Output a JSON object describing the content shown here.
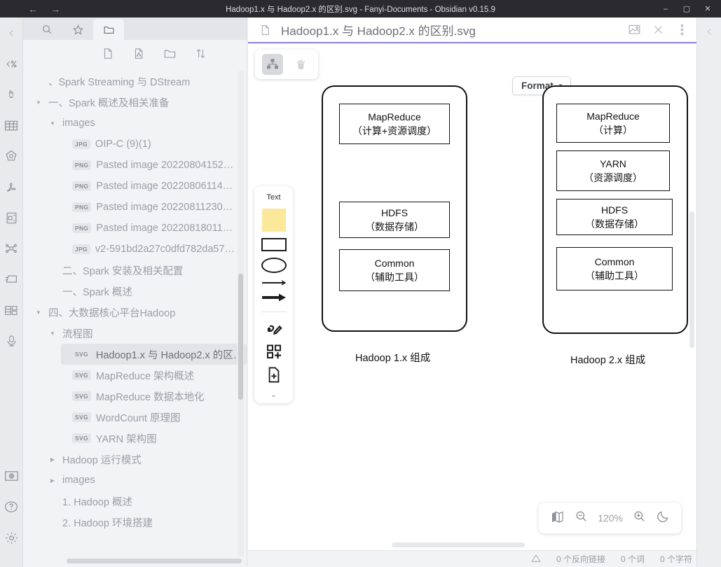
{
  "window": {
    "title": "Hadoop1.x 与 Hadoop2.x 的区别.svg - Fanyi-Documents - Obsidian v0.15.9",
    "back_icon": "arrow-left-icon",
    "forward_icon": "arrow-right-icon",
    "minimize": "–",
    "maximize": "▢",
    "close": "✕"
  },
  "rail": {
    "items": [
      {
        "name": "collapse-chevron-icon",
        "glyph": "chevron-left"
      },
      {
        "name": "percent-code-icon",
        "glyph": "code-percent"
      },
      {
        "name": "clip-icon",
        "glyph": "clip"
      },
      {
        "name": "table-icon",
        "glyph": "table"
      },
      {
        "name": "shape-icon",
        "glyph": "polygon"
      },
      {
        "name": "pdf-icon",
        "glyph": "pdf"
      },
      {
        "name": "card-icon",
        "glyph": "card"
      },
      {
        "name": "graph-icon",
        "glyph": "graph"
      },
      {
        "name": "layers-icon",
        "glyph": "layers"
      },
      {
        "name": "grid-icon",
        "glyph": "grid"
      },
      {
        "name": "microphone-icon",
        "glyph": "mic"
      },
      {
        "name": "camera-icon",
        "glyph": "camera"
      },
      {
        "name": "help-icon",
        "glyph": "question"
      },
      {
        "name": "settings-icon",
        "glyph": "gear"
      }
    ]
  },
  "sidebar": {
    "tabs": [
      {
        "name": "search-tab",
        "icon": "search-icon",
        "active": false
      },
      {
        "name": "bookmark-tab",
        "icon": "star-icon",
        "active": false
      },
      {
        "name": "files-tab",
        "icon": "folder-icon",
        "active": true
      }
    ],
    "actions": [
      {
        "name": "new-note-action",
        "icon": "new-file-icon"
      },
      {
        "name": "new-drawing-action",
        "icon": "drawing-file-icon"
      },
      {
        "name": "new-folder-action",
        "icon": "new-folder-icon"
      },
      {
        "name": "sort-action",
        "icon": "sort-icon"
      }
    ],
    "tree": [
      {
        "label": "、Spark Streaming 与 DStream",
        "indent": 1,
        "arrow": "",
        "badge": "",
        "selected": false,
        "clipped": true
      },
      {
        "label": "一、Spark 概述及相关准备",
        "indent": 1,
        "arrow": "▼",
        "badge": "",
        "selected": false
      },
      {
        "label": "images",
        "indent": 2,
        "arrow": "▼",
        "badge": "",
        "selected": false
      },
      {
        "label": "OIP-C (9)(1)",
        "indent": 3,
        "arrow": "",
        "badge": "JPG",
        "selected": false
      },
      {
        "label": "Pasted image 20220804152…",
        "indent": 3,
        "arrow": "",
        "badge": "PNG",
        "selected": false
      },
      {
        "label": "Pasted image 20220806114…",
        "indent": 3,
        "arrow": "",
        "badge": "PNG",
        "selected": false
      },
      {
        "label": "Pasted image 20220811230…",
        "indent": 3,
        "arrow": "",
        "badge": "PNG",
        "selected": false
      },
      {
        "label": "Pasted image 20220818011…",
        "indent": 3,
        "arrow": "",
        "badge": "PNG",
        "selected": false
      },
      {
        "label": "v2-591bd2a27c0dfd782da57…",
        "indent": 3,
        "arrow": "",
        "badge": "JPG",
        "selected": false
      },
      {
        "label": "二、Spark 安装及相关配置",
        "indent": 2,
        "arrow": "",
        "badge": "",
        "selected": false
      },
      {
        "label": "一、Spark 概述",
        "indent": 2,
        "arrow": "",
        "badge": "",
        "selected": false
      },
      {
        "label": "四、大数据核心平台Hadoop",
        "indent": 1,
        "arrow": "▼",
        "badge": "",
        "selected": false
      },
      {
        "label": "流程图",
        "indent": 2,
        "arrow": "▼",
        "badge": "",
        "selected": false
      },
      {
        "label": "Hadoop1.x 与 Hadoop2.x 的区…",
        "indent": 3,
        "arrow": "",
        "badge": "SVG",
        "selected": true
      },
      {
        "label": "MapReduce 架构概述",
        "indent": 3,
        "arrow": "",
        "badge": "SVG",
        "selected": false
      },
      {
        "label": "MapReduce 数据本地化",
        "indent": 3,
        "arrow": "",
        "badge": "SVG",
        "selected": false
      },
      {
        "label": "WordCount 原理图",
        "indent": 3,
        "arrow": "",
        "badge": "SVG",
        "selected": false
      },
      {
        "label": "YARN 架构图",
        "indent": 3,
        "arrow": "",
        "badge": "SVG",
        "selected": false
      },
      {
        "label": "Hadoop 运行模式",
        "indent": 2,
        "arrow": "▶",
        "badge": "",
        "selected": false
      },
      {
        "label": "images",
        "indent": 2,
        "arrow": "▶",
        "badge": "",
        "selected": false
      },
      {
        "label": "1. Hadoop 概述",
        "indent": 2,
        "arrow": "",
        "badge": "",
        "selected": false
      },
      {
        "label": "2. Hadoop 环境搭建",
        "indent": 2,
        "arrow": "",
        "badge": "",
        "selected": false
      }
    ]
  },
  "tab_header": {
    "icon": "document-icon",
    "title": "Hadoop1.x 与 Hadoop2.x 的区别.svg",
    "actions": [
      {
        "name": "image-view-button",
        "icon": "image-icon"
      },
      {
        "name": "close-tab-button",
        "icon": "close-icon"
      },
      {
        "name": "more-options-button",
        "icon": "vertical-dots-icon"
      }
    ],
    "accent_color": "#8a7de0"
  },
  "canvas_toolbar": {
    "buttons": [
      {
        "name": "diagram-tool-button",
        "icon": "sitemap-icon",
        "active": true
      },
      {
        "name": "delete-button",
        "icon": "trash-icon",
        "active": false
      }
    ],
    "format_label": "Format",
    "format_chevron": "▾"
  },
  "palette": {
    "text_label": "Text",
    "items": [
      {
        "name": "sticky-note-tool",
        "icon": "sticky-note-icon"
      },
      {
        "name": "rectangle-tool",
        "icon": "rectangle-icon"
      },
      {
        "name": "ellipse-tool",
        "icon": "ellipse-icon"
      },
      {
        "name": "line-tool",
        "icon": "line-icon"
      },
      {
        "name": "arrow-tool",
        "icon": "arrow-icon"
      },
      {
        "name": "freedraw-tool",
        "icon": "pencil-scribble-icon"
      },
      {
        "name": "add-shape-library-tool",
        "icon": "shapes-plus-icon"
      },
      {
        "name": "add-file-tool",
        "icon": "file-plus-icon"
      }
    ],
    "expand_chevron": "⌄"
  },
  "diagram": {
    "left": {
      "caption": "Hadoop 1.x 组成",
      "boxes": [
        {
          "title": "MapReduce",
          "sub": "（计算+资源调度）"
        },
        {
          "title": "HDFS",
          "sub": "（数据存储）"
        },
        {
          "title": "Common",
          "sub": "（辅助工具）"
        }
      ]
    },
    "right": {
      "caption": "Hadoop 2.x 组成",
      "boxes": [
        {
          "title": "MapReduce",
          "sub": "（计算）"
        },
        {
          "title": "YARN",
          "sub": "（资源调度）"
        },
        {
          "title": "HDFS",
          "sub": "（数据存储）"
        },
        {
          "title": "Common",
          "sub": "（辅助工具）"
        }
      ]
    }
  },
  "zoombar": {
    "map_icon": "map-icon",
    "zoom_out_icon": "zoom-out-icon",
    "zoom_level": "120%",
    "zoom_in_icon": "zoom-in-icon",
    "theme_icon": "moon-icon"
  },
  "status_bar": {
    "warn_icon": "warning-icon",
    "backlinks": "0 个反向链接",
    "words": "0 个词",
    "chars": "0 个字符"
  },
  "right_rail": {
    "chevron": "chevron-left-icon"
  }
}
